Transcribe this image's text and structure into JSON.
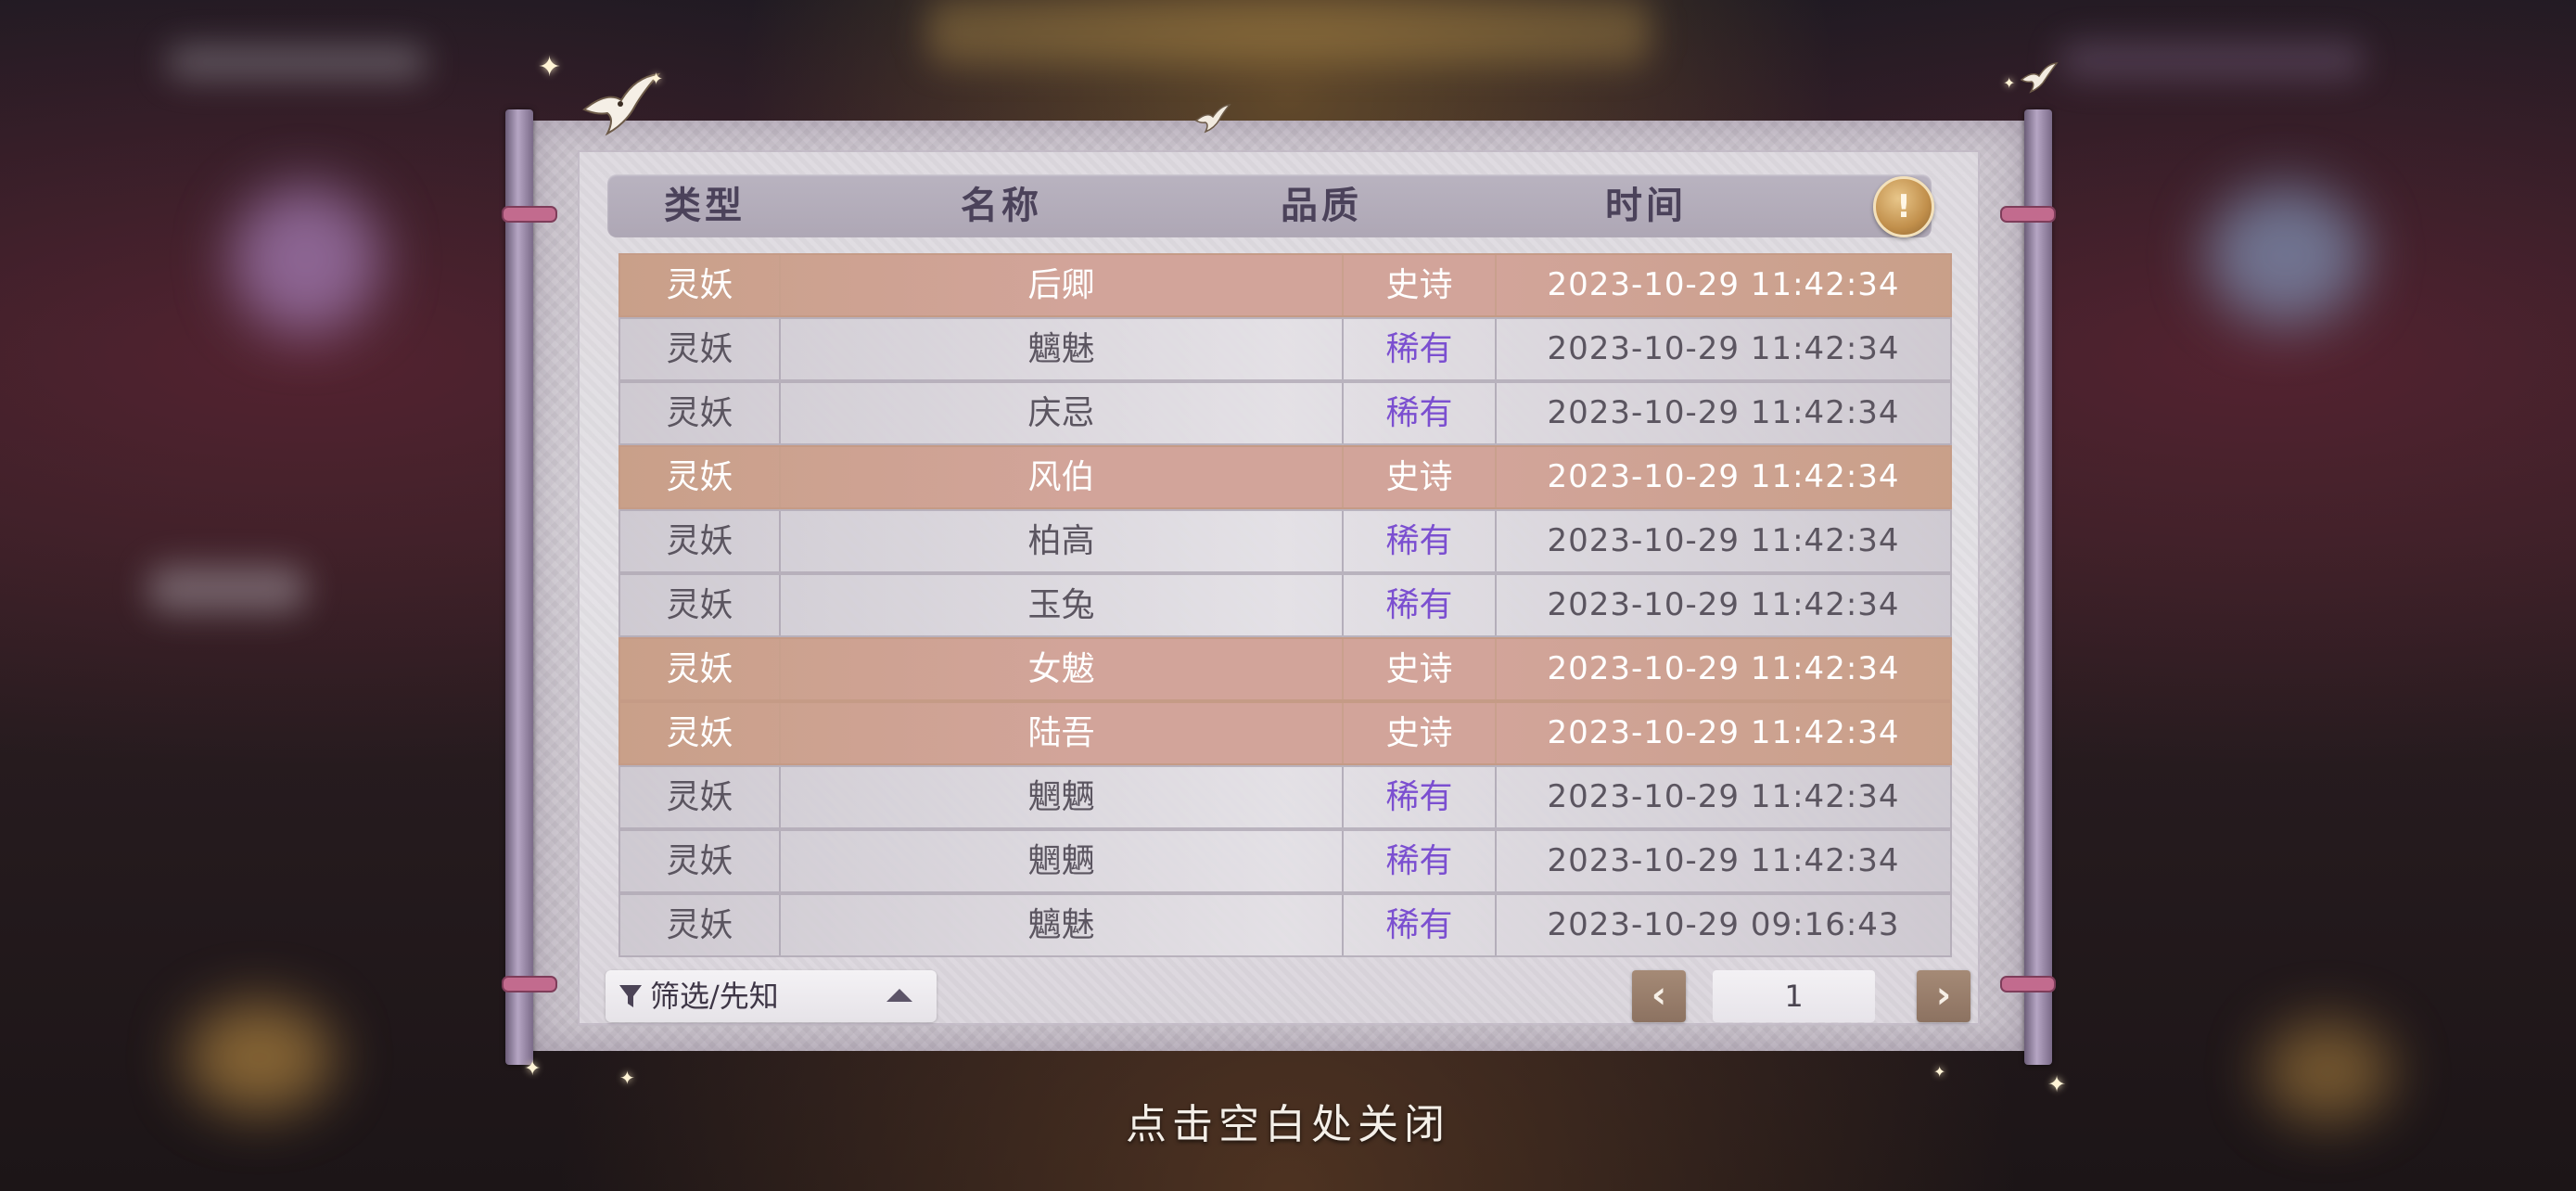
{
  "table": {
    "headers": {
      "type": "类型",
      "name": "名称",
      "quality": "品质",
      "time": "时间"
    },
    "rows": [
      {
        "type": "灵妖",
        "name": "后卿",
        "quality": "史诗",
        "time": "2023-10-29  11:42:34",
        "tier": "epic"
      },
      {
        "type": "灵妖",
        "name": "魑魅",
        "quality": "稀有",
        "time": "2023-10-29  11:42:34",
        "tier": "rare"
      },
      {
        "type": "灵妖",
        "name": "庆忌",
        "quality": "稀有",
        "time": "2023-10-29  11:42:34",
        "tier": "rare"
      },
      {
        "type": "灵妖",
        "name": "风伯",
        "quality": "史诗",
        "time": "2023-10-29  11:42:34",
        "tier": "epic"
      },
      {
        "type": "灵妖",
        "name": "柏高",
        "quality": "稀有",
        "time": "2023-10-29  11:42:34",
        "tier": "rare"
      },
      {
        "type": "灵妖",
        "name": "玉兔",
        "quality": "稀有",
        "time": "2023-10-29  11:42:34",
        "tier": "rare"
      },
      {
        "type": "灵妖",
        "name": "女魃",
        "quality": "史诗",
        "time": "2023-10-29  11:42:34",
        "tier": "epic"
      },
      {
        "type": "灵妖",
        "name": "陆吾",
        "quality": "史诗",
        "time": "2023-10-29  11:42:34",
        "tier": "epic"
      },
      {
        "type": "灵妖",
        "name": "魍魉",
        "quality": "稀有",
        "time": "2023-10-29  11:42:34",
        "tier": "rare"
      },
      {
        "type": "灵妖",
        "name": "魍魉",
        "quality": "稀有",
        "time": "2023-10-29  11:42:34",
        "tier": "rare"
      },
      {
        "type": "灵妖",
        "name": "魑魅",
        "quality": "稀有",
        "time": "2023-10-29  09:16:43",
        "tier": "rare"
      }
    ]
  },
  "footer": {
    "filter_label": "筛选/先知",
    "page_number": "1",
    "prev_glyph": "‹",
    "next_glyph": "›"
  },
  "tip_glyph": "!",
  "close_hint": "点击空白处关闭",
  "colors": {
    "epic_row": "#d2a49a",
    "rare_quality_text": "#7b4fd0",
    "page_button": "#8c7261"
  },
  "icons": {
    "filter": "funnel-icon",
    "collapse": "chevron-up-icon",
    "prev": "chevron-left-icon",
    "next": "chevron-right-icon",
    "tip": "lightbulb-icon"
  }
}
